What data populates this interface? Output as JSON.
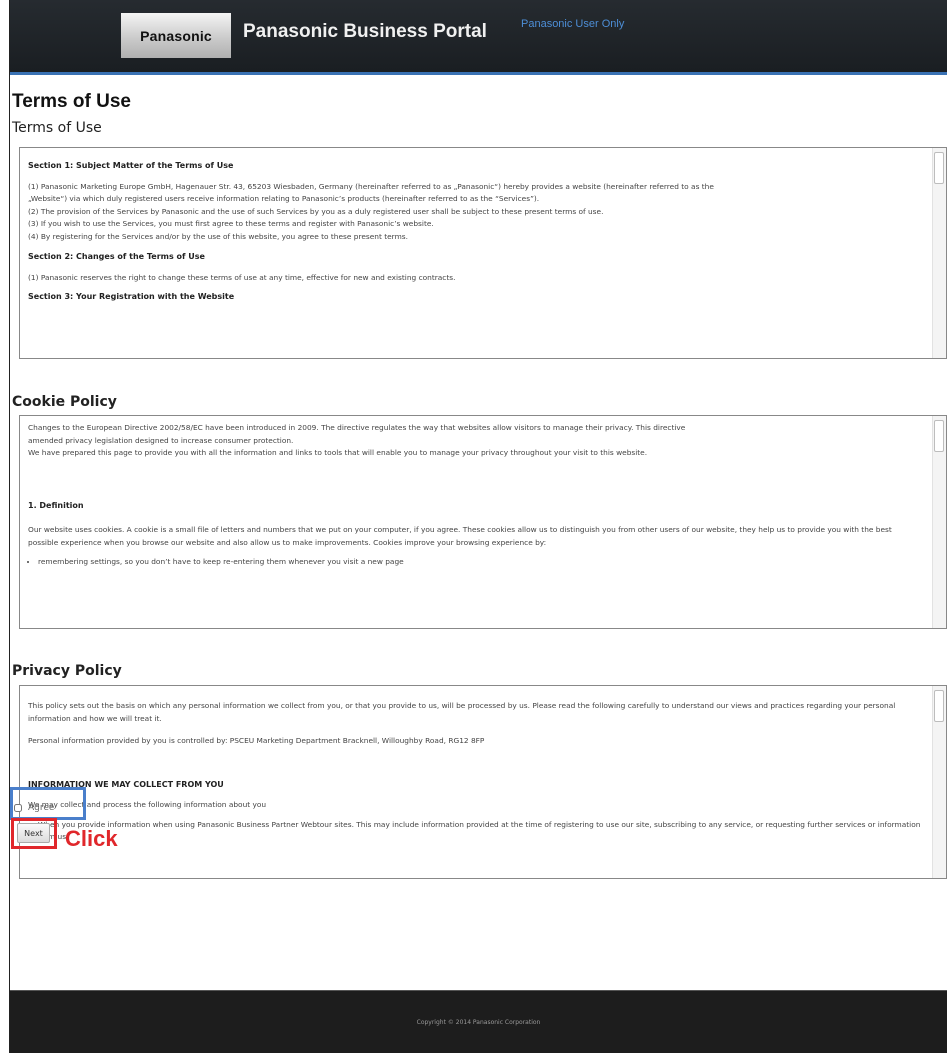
{
  "header": {
    "logo": "Panasonic",
    "title": "Panasonic Business Portal",
    "subtitle": "Panasonic User Only"
  },
  "page": {
    "title": "Terms of Use"
  },
  "terms": {
    "heading": "Terms of Use",
    "section1_title": "Section 1: Subject Matter of the Terms of Use",
    "s1_p1a": "(1) Panasonic Marketing Europe GmbH, Hagenauer Str. 43, 65203 Wiesbaden, Germany (hereinafter referred to as „Panasonic“) hereby provides a website (hereinafter referred to as the",
    "s1_p1b": "„Website“) via which duly registered users receive information relating to Panasonic’s products (hereinafter referred to as the “Services”).",
    "s1_p2": "(2) The provision of the Services by Panasonic and the use of such Services by you as a duly registered user shall be subject to these present terms of use.",
    "s1_p3": "(3) If you wish to use the Services, you must first agree to these terms and register with Panasonic’s website.",
    "s1_p4": "(4) By registering for the Services and/or by the use of this website, you agree to these present terms.",
    "section2_title": "Section 2: Changes of the Terms of Use",
    "s2_p1": "(1) Panasonic reserves the right to change these terms of use at any time, effective for new and existing contracts.",
    "section3_title": "Section 3: Your Registration with the Website"
  },
  "cookie": {
    "heading": "Cookie Policy",
    "p1a": "Changes to the European Directive 2002/58/EC have been introduced in 2009. The directive regulates the way that websites allow visitors to manage their privacy. This directive",
    "p1b": "amended privacy legislation designed to increase consumer protection.",
    "p1c": "We have prepared this page to provide you with all the information and links to tools that will enable you to manage your privacy throughout your visit to this website.",
    "def_title": "1. Definition",
    "p2": "Our website uses cookies. A cookie is a small file of letters and numbers that we put on your computer, if you agree. These cookies allow us to distinguish you from other users of our website, they help us to provide you with the best possible experience when you browse our website and also allow us to make improvements. Cookies improve your browsing experience by:",
    "bullet1": "remembering settings, so you don’t have to keep re-entering them whenever you visit a new page"
  },
  "privacy": {
    "heading": "Privacy Policy",
    "p1": "This policy sets out the basis on which any personal information we collect from you, or that you provide to us, will be processed by us. Please read the following carefully to understand our views and practices regarding your personal information and how we will treat it.",
    "p2": "Personal information provided by you is controlled by: PSCEU Marketing Department Bracknell, Willoughby Road, RG12 8FP",
    "collect_title": "INFORMATION WE MAY COLLECT FROM YOU",
    "p3": "We may collect and process the following information about you",
    "bullet1": "When you provide information when using Panasonic Business Partner Webtour sites. This may include information provided at the time of registering to use our site, subscribing to any service, or requesting further services or information from us."
  },
  "form": {
    "agree_label": "Agree",
    "next_label": "Next",
    "annotation": "Click"
  },
  "footer": {
    "copyright": "Copyright © 2014 Panasonic Corporation"
  }
}
